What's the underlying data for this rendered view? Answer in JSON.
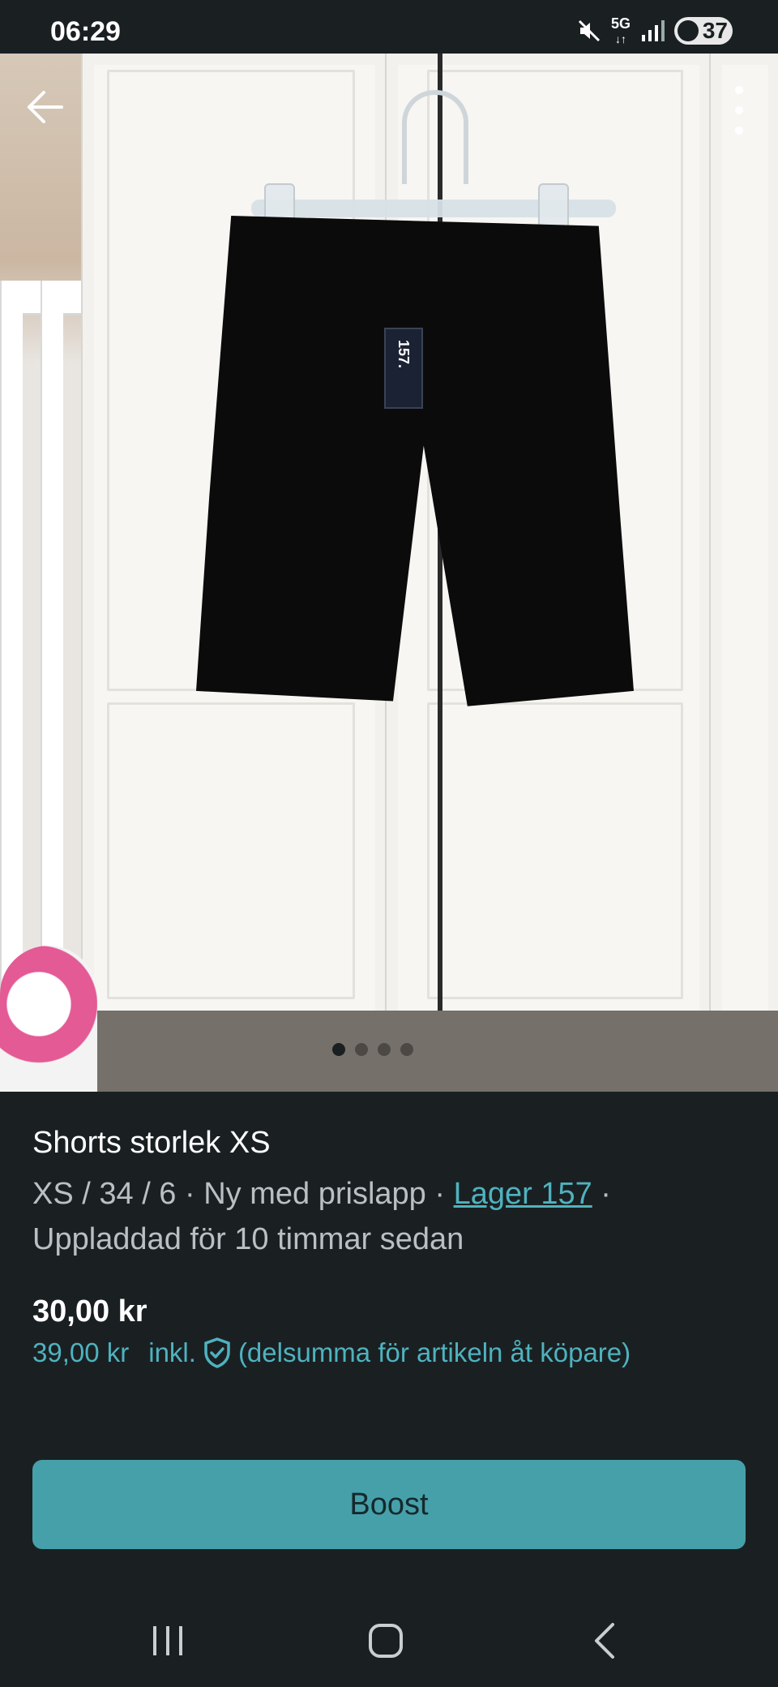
{
  "status_bar": {
    "time": "06:29",
    "network": "5G",
    "battery": "37"
  },
  "photo": {
    "page_count": 4,
    "active_index": 0,
    "tag_text": "157."
  },
  "item": {
    "title": "Shorts storlek XS",
    "size": "XS / 34 / 6",
    "separator": " · ",
    "condition": "Ny med prislapp",
    "brand": "Lager 157",
    "uploaded": "Uppladdad för 10 timmar sedan",
    "price": "30,00 kr",
    "price_incl": "39,00 kr",
    "incl_label": "inkl.",
    "incl_note": "(delsumma för artikeln åt köpare)"
  },
  "actions": {
    "boost_label": "Boost"
  },
  "colors": {
    "background": "#1a2022",
    "accent": "#4fb2bf",
    "button": "#46a0aa"
  }
}
